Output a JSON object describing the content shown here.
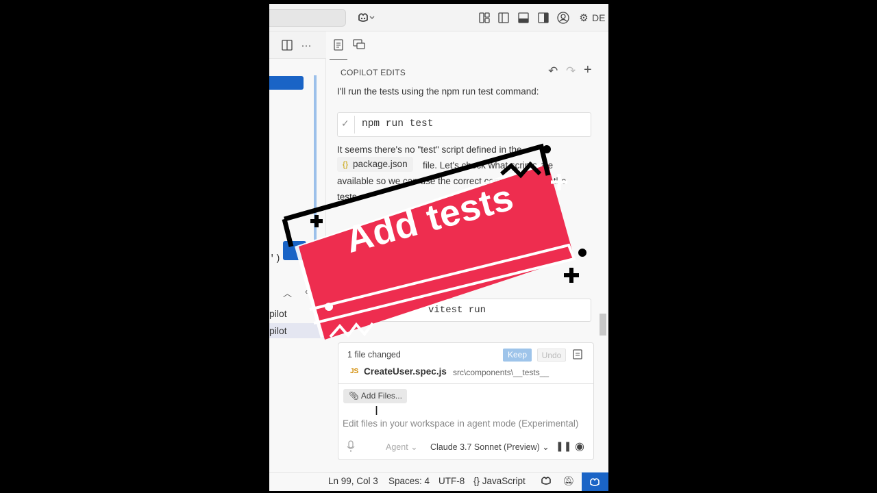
{
  "titlebar": {
    "icons": [
      "copilot-icon",
      "layout-icon",
      "sidebar-left-icon",
      "panel-bottom-icon",
      "sidebar-right-icon",
      "account-icon",
      "gear-icon"
    ],
    "truncated_text": "DE"
  },
  "editor": {
    "paren_text": "')",
    "sidebar_items": [
      "pilot",
      "pilot"
    ]
  },
  "chat": {
    "panel_title": "COPILOT EDITS",
    "messages": {
      "run_tests": "I'll run the tests using the npm run test command:",
      "command": "npm run test",
      "no_test_line1": "It seems there's no \"test\" script defined in the",
      "pkg_chip": "package.json",
      "no_test_line2": "file. Let's check what scripts are",
      "no_test_line3": "available so we can use the correct command to run the",
      "no_test_line4": "tests",
      "command2_partial": "vitest run"
    },
    "changes": {
      "count_label": "1 file changed",
      "keep_label": "Keep",
      "undo_label": "Undo",
      "file_type": "JS",
      "file_name": "CreateUser.spec.js",
      "file_path": "src\\components\\__tests__"
    },
    "input": {
      "add_files_label": "Add Files...",
      "placeholder": "Edit files in your workspace in agent mode (Experimental)",
      "agent_label": "Agent",
      "model_label": "Claude 3.7 Sonnet (Preview)"
    }
  },
  "statusbar": {
    "position": "Ln 99, Col 3",
    "spaces": "Spaces: 4",
    "encoding": "UTF-8",
    "language": "JavaScript"
  },
  "overlay": {
    "text": "Add tests",
    "colors": {
      "fill": "#ee2d4f",
      "outline": "#000000",
      "text": "#ffffff"
    }
  }
}
